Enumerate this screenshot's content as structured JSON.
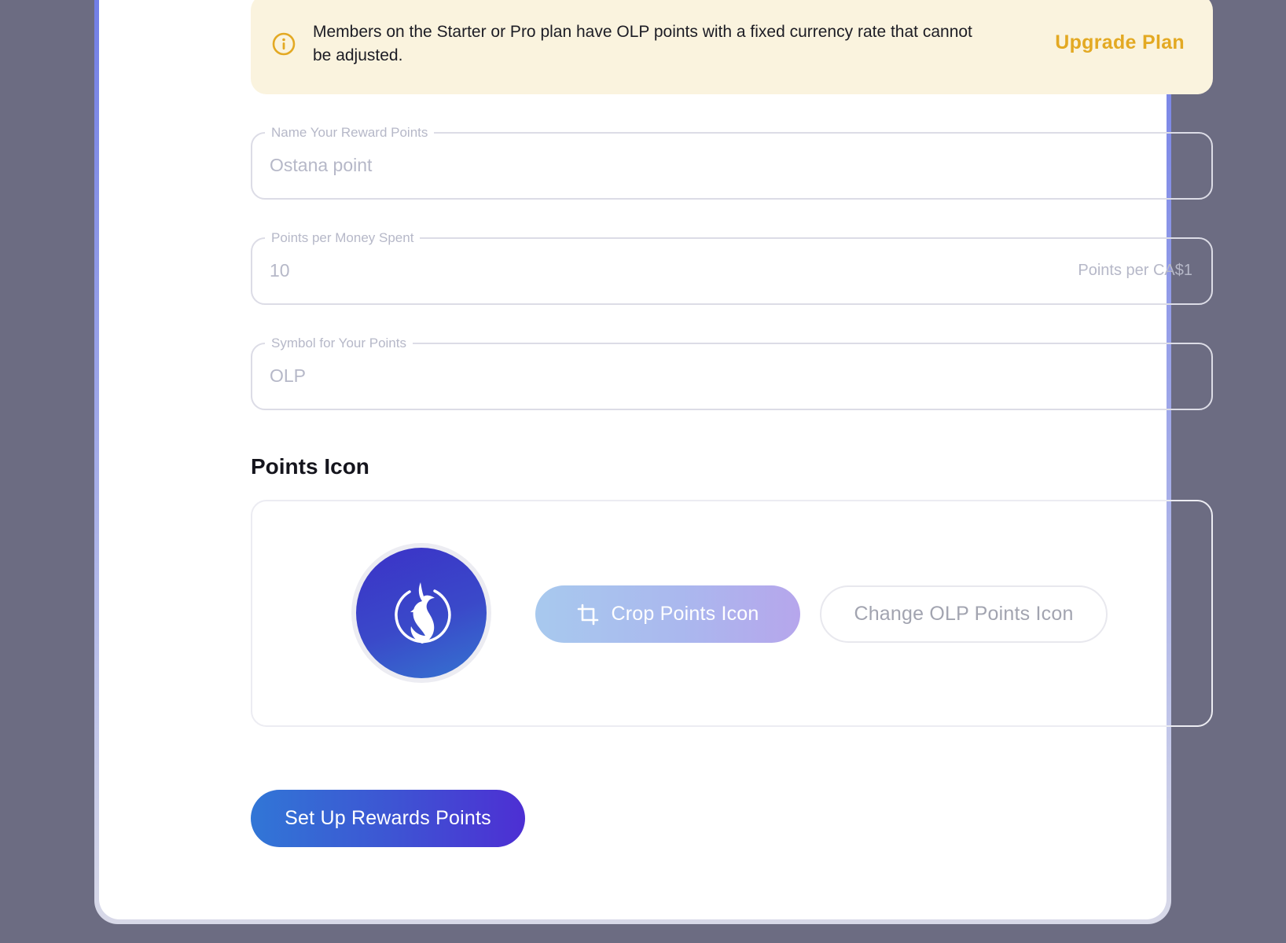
{
  "notice": {
    "icon": "info-circle-icon",
    "text": "Members on the Starter or Pro plan have OLP points with a fixed currency rate that cannot be adjusted.",
    "action_label": "Upgrade Plan",
    "action_color": "#e3a923",
    "background_color": "#faf3de"
  },
  "fields": {
    "name": {
      "label": "Name Your Reward Points",
      "value": "Ostana point"
    },
    "rate": {
      "label": "Points per Money Spent",
      "value": "10",
      "suffix": "Points per CA$1"
    },
    "symbol": {
      "label": "Symbol for Your Points",
      "value": "OLP"
    }
  },
  "points_icon": {
    "title": "Points Icon",
    "avatar_icon": "dragon-emblem-icon",
    "crop_icon": "crop-icon",
    "crop_label": "Crop Points Icon",
    "change_label": "Change OLP Points Icon"
  },
  "submit": {
    "label": "Set Up Rewards Points"
  }
}
